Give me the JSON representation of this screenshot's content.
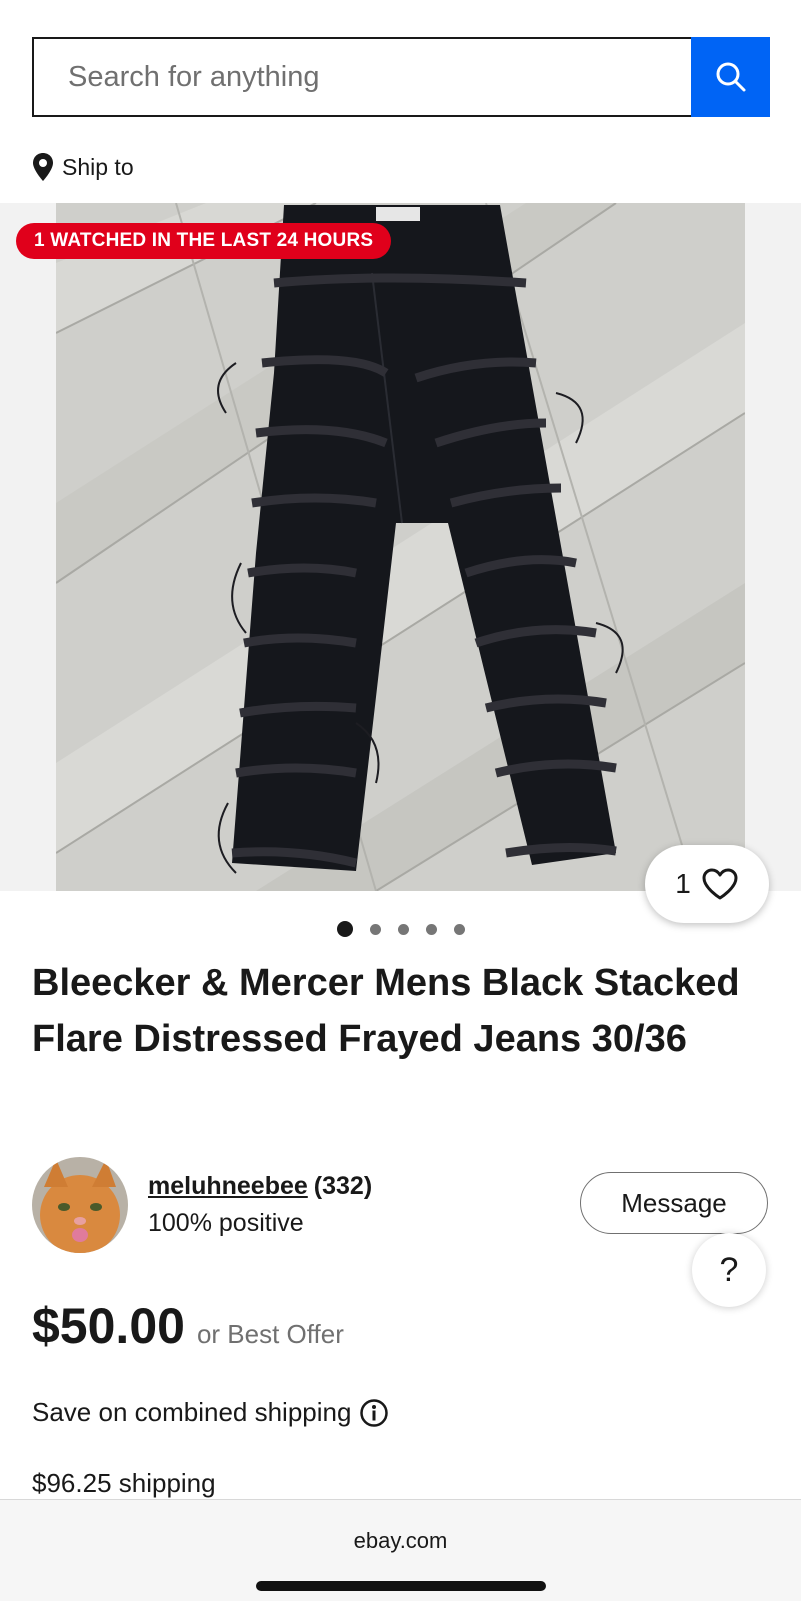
{
  "search": {
    "placeholder": "Search for anything"
  },
  "ship_to": {
    "label": "Ship to"
  },
  "gallery": {
    "badge": "1 WATCHED IN THE LAST 24 HOURS",
    "watch_count": "1",
    "dots_total": 5,
    "active_dot": 1
  },
  "listing": {
    "title": "Bleecker & Mercer Mens Black Stacked Flare Distressed Frayed Jeans 30/36"
  },
  "seller": {
    "name": "meluhneebee",
    "feedback": "(332)",
    "positive": "100% positive",
    "message_label": "Message"
  },
  "help": {
    "label": "?"
  },
  "price": {
    "amount": "$50.00",
    "best_offer": "or Best Offer"
  },
  "shipping": {
    "combined": "Save on combined shipping",
    "cost": "$96.25 shipping"
  },
  "browser": {
    "url": "ebay.com"
  },
  "colors": {
    "accent_blue": "#0064f5",
    "badge_red": "#e0001b",
    "text": "#191919",
    "muted": "#707070"
  },
  "icons": [
    "search-icon",
    "location-pin-icon",
    "heart-icon",
    "info-icon",
    "chevron-right-icon"
  ]
}
